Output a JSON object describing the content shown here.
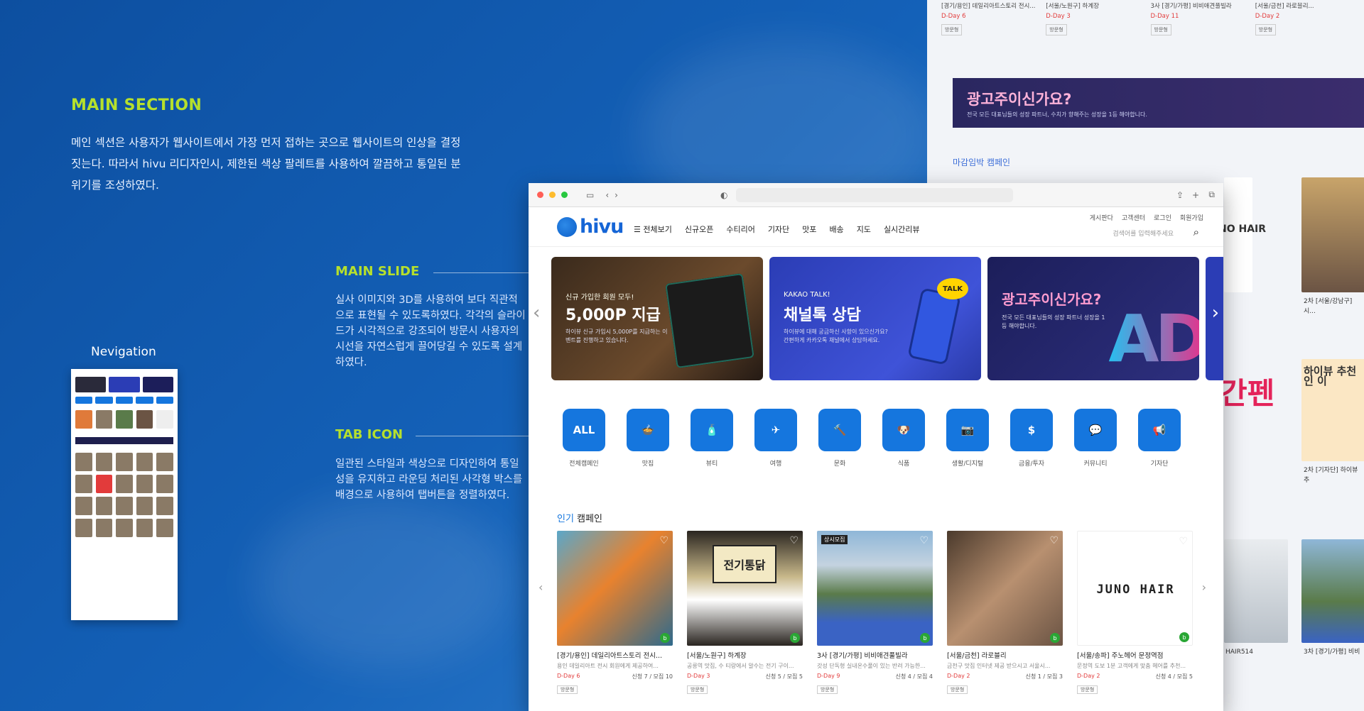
{
  "intro": {
    "title": "MAIN SECTION",
    "text": "메인 섹션은 사용자가 웹사이트에서 가장 먼저 접하는 곳으로 웹사이트의 인상을 결정짓는다. 따라서 hivu 리디자인시, 제한된 색상 팔레트를 사용하여 깔끔하고 통일된 분위기를 조성하였다."
  },
  "main_slide": {
    "title": "MAIN SLIDE",
    "text": "실사 이미지와 3D를 사용하여 보다 직관적으로 표현될 수 있도록하였다. 각각의 슬라이드가 시각적으로 강조되어 방문시 사용자의 시선을 자연스럽게 끌어당길 수 있도록 설계하였다."
  },
  "tab_icon": {
    "title": "TAB ICON",
    "text": "일관된 스타일과 색상으로 디자인하여 통일성을 유지하고 라운딩 처리된 사각형 박스를 배경으로 사용하여 탭버튼을 정렬하였다."
  },
  "navigation": {
    "title": "Nevigation"
  },
  "background_page": {
    "top_items": [
      {
        "name": "[경기/용인] 데일리아트스토리 전시...",
        "dday": "D-Day 6"
      },
      {
        "name": "[서울/노원구] 하계장",
        "dday": "D-Day 3"
      },
      {
        "name": "3사 [경기/가평] 비비애견풀빌라",
        "dday": "D-Day 11"
      },
      {
        "name": "[서울/금천] 라로블리...",
        "dday": "D-Day 2"
      }
    ],
    "ad_title": "광고주이신가요?",
    "ad_sub": "전국 모든 대표님들의 성장 파트너, 수치가 향해주는 성장을 1등 해야합니다.",
    "deadline_title": "마감임박 캠페인",
    "side_items": [
      {
        "name": "NO HAIR"
      },
      {
        "name": "2차 [서울/강남구] 시..."
      },
      {
        "name": "하이뷰 추천인 이"
      },
      {
        "name": "2차 [기자단] 하이뷰 추"
      },
      {
        "name": "간펜"
      },
      {
        "name": "HAIR514"
      },
      {
        "name": "3차 [경기/가평] 비비"
      }
    ]
  },
  "browser": {
    "brand": "hivu",
    "menu": [
      "☰ 전체보기",
      "신규오픈",
      "수티리어",
      "기자단",
      "맛포",
      "배송",
      "지도",
      "실시간리뷰"
    ],
    "util": [
      "게시판다",
      "고객센터",
      "로그인",
      "회원가입"
    ],
    "search_placeholder": "검색어를 입력해주세요",
    "slides": [
      {
        "small": "신규 가입한 회원 모두!",
        "big": "5,000P 지급",
        "desc": "하이뷰 신규 가입시 5,000P를 지급하는 이벤트를 진행하고 있습니다."
      },
      {
        "small": "KAKAO TALK!",
        "big": "채널톡 상담",
        "desc": "하이뷰에 대해 궁금하신 사항이 있으신가요? 간편하게 카카오톡 채널에서 상담하세요.",
        "badge": "TALK"
      },
      {
        "small": "",
        "big": "광고주이신가요?",
        "desc": "전국 모든 대표님들의 성장 파트너 성장을 1등 해야합니다.",
        "art": "AD"
      }
    ],
    "tabs": [
      {
        "icon": "ALL",
        "label": "전체캠페인"
      },
      {
        "icon": "🍲",
        "label": "맛집"
      },
      {
        "icon": "🧴",
        "label": "뷰티"
      },
      {
        "icon": "✈",
        "label": "여행"
      },
      {
        "icon": "🔨",
        "label": "문화"
      },
      {
        "icon": "🐶",
        "label": "식품"
      },
      {
        "icon": "📷",
        "label": "생활/디지털"
      },
      {
        "icon": "$",
        "label": "금융/투자"
      },
      {
        "icon": "💬",
        "label": "커뮤니티"
      },
      {
        "icon": "📢",
        "label": "기자단"
      }
    ],
    "section_title_blue": "인기",
    "section_title_rest": " 캠페인",
    "cards": [
      {
        "name": "[경기/용인] 데일리아트스토리 전시...",
        "info": "용인 데일리아트 전시 회원에게 제공하여...",
        "dday": "D-Day 6",
        "count": "신청 7 / 모집 10",
        "tag": "방문형"
      },
      {
        "name": "[서울/노원구] 하계장",
        "info": "공릉역 맛집, 수 티랑에서 알수는 전기 구이...",
        "dday": "D-Day 3",
        "count": "신청 5 / 모집 5",
        "tag": "방문형",
        "sign": "전기통닭"
      },
      {
        "name": "3사 [경기/가평] 비비애견풀빌라",
        "info": "갓성 단독형 실내온수풀이 있는 반려 가능한...",
        "dday": "D-Day 9",
        "count": "신청 4 / 모집 4",
        "tag": "방문형",
        "badge": "상시모집"
      },
      {
        "name": "[서울/금천] 라로블리",
        "info": "금천구 맛집 인터넷 제공 받으시고 서울시...",
        "dday": "D-Day 2",
        "count": "신청 1 / 모집 3",
        "tag": "방문형"
      },
      {
        "name": "[서울/송파] 주노헤어 문정역점",
        "info": "문정역 도보 1분 고객에게 맞춤 헤어를 추천...",
        "dday": "D-Day 2",
        "count": "신청 4 / 모집 5",
        "tag": "방문형",
        "logo": "JUNO HAIR"
      }
    ]
  }
}
